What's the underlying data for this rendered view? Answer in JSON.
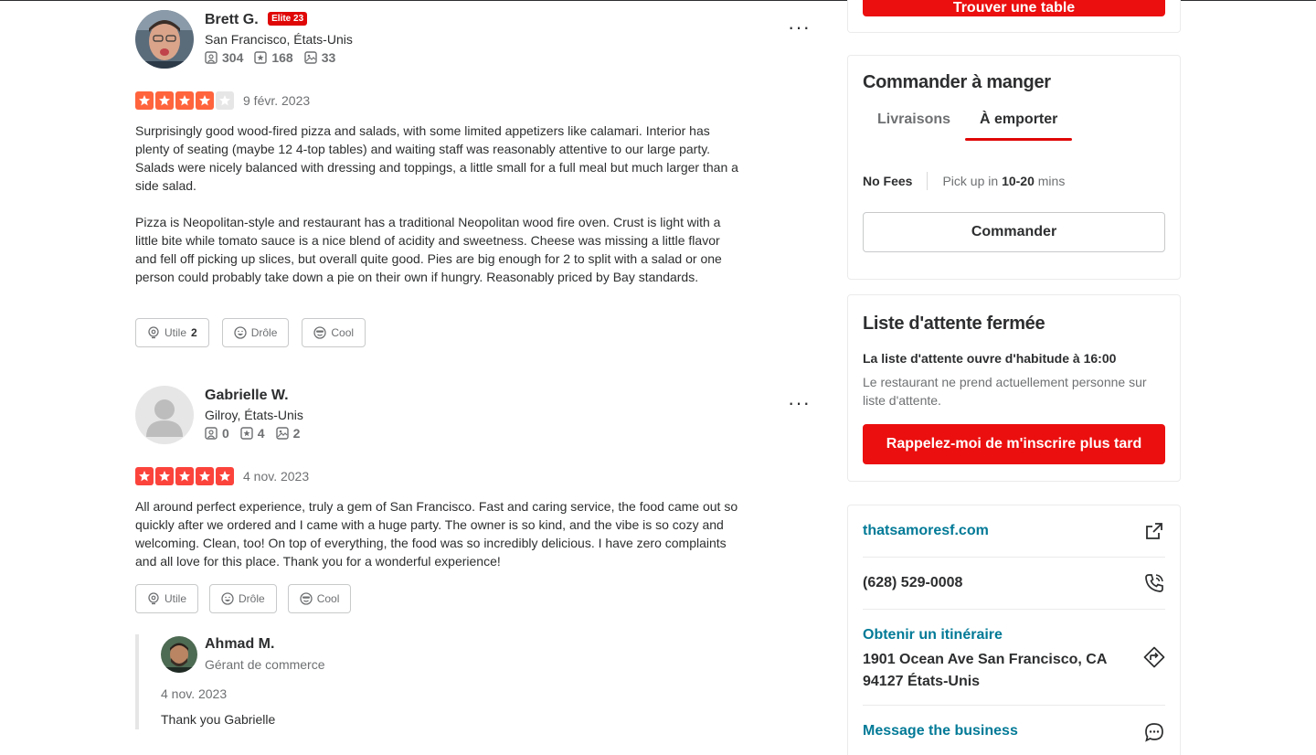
{
  "reviews": [
    {
      "user": "Brett G.",
      "elite": "Elite 23",
      "location": "San Francisco, États-Unis",
      "stats": {
        "reviews": "304",
        "friends": "168",
        "photos": "33"
      },
      "rating": 4,
      "date": "9 févr. 2023",
      "paragraphs": [
        "Surprisingly good wood-fired pizza and salads, with some limited appetizers like calamari. Interior has plenty of seating (maybe 12 4-top tables) and waiting staff was reasonably attentive to our large party. Salads were nicely balanced with dressing and toppings, a little small for a full meal but much larger than a side salad.",
        "Pizza is Neopolitan-style and restaurant has a traditional Neopolitan wood fire oven. Crust is light with a little bite while tomato sauce is a nice blend of acidity and sweetness. Cheese was missing a little flavor and fell off picking up slices, but overall quite good. Pies are big enough for 2 to split with a salad or one person could probably take down a pie on their own if hungry. Reasonably priced by Bay standards."
      ],
      "actions": {
        "useful": "Utile",
        "useful_count": "2",
        "funny": "Drôle",
        "cool": "Cool"
      }
    },
    {
      "user": "Gabrielle W.",
      "location": "Gilroy, États-Unis",
      "stats": {
        "reviews": "0",
        "friends": "4",
        "photos": "2"
      },
      "rating": 5,
      "date": "4 nov. 2023",
      "paragraphs": [
        "All around perfect experience, truly a gem of San Francisco. Fast and caring service, the food came out so quickly after we ordered and I came with a huge party. The owner is so kind, and the vibe is so cozy and welcoming. Clean, too! On top of everything, the food was so incredibly delicious. I have zero complaints and all love for this place. Thank you for a wonderful experience!"
      ],
      "actions": {
        "useful": "Utile",
        "funny": "Drôle",
        "cool": "Cool"
      }
    }
  ],
  "owner_reply": {
    "name": "Ahmad M.",
    "role": "Gérant de commerce",
    "date": "4 nov. 2023",
    "text": "Thank you Gabrielle"
  },
  "more_label": "···",
  "sidebar": {
    "reserve_button": "Trouver une table",
    "order": {
      "title": "Commander à manger",
      "tabs": [
        "Livraisons",
        "À emporter"
      ],
      "active_tab": 1,
      "no_fees": "No Fees",
      "pickup_prefix": "Pick up in ",
      "pickup_time": "10-20",
      "pickup_suffix": " mins",
      "button": "Commander"
    },
    "waitlist": {
      "title": "Liste d'attente fermée",
      "opens": "La liste d'attente ouvre d'habitude à 16:00",
      "description": "Le restaurant ne prend actuellement personne sur liste d'attente.",
      "button": "Rappelez-moi de m'inscrire plus tard"
    },
    "info": {
      "website": "thatsamoresf.com",
      "phone": "(628) 529-0008",
      "directions_label": "Obtenir un itinéraire",
      "address": "1901 Ocean Ave San Francisco, CA 94127 États-Unis",
      "message": "Message the business"
    }
  },
  "colors": {
    "brand_red": "#eb0f0f",
    "star_4": "#ff643d",
    "star_5": "#fb433c",
    "link": "#027a97"
  }
}
